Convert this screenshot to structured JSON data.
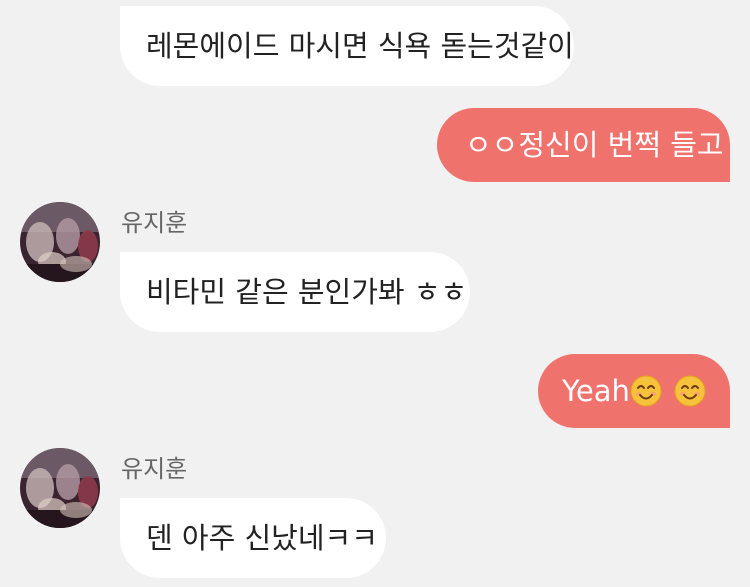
{
  "colors": {
    "background": "#f1f1f1",
    "incoming_bubble": "#ffffff",
    "outgoing_bubble": "#ef726d",
    "sender_name": "#666666"
  },
  "messages": [
    {
      "direction": "in",
      "text": "레몬에이드 마시면 식욕 돋는것같이"
    },
    {
      "direction": "out",
      "text": "ㅇㅇ정신이 번쩍 들고"
    },
    {
      "direction": "in",
      "sender": "유지훈",
      "avatar": "avatar-wine-glasses",
      "text": "비타민 같은 분인가봐 ㅎㅎ"
    },
    {
      "direction": "out",
      "text": "Yeah",
      "emojis": [
        "smiling-face-icon",
        "smiling-face-icon"
      ]
    },
    {
      "direction": "in",
      "sender": "유지훈",
      "avatar": "avatar-wine-glasses",
      "text": "덴 아주 신났네ㅋㅋ"
    }
  ]
}
